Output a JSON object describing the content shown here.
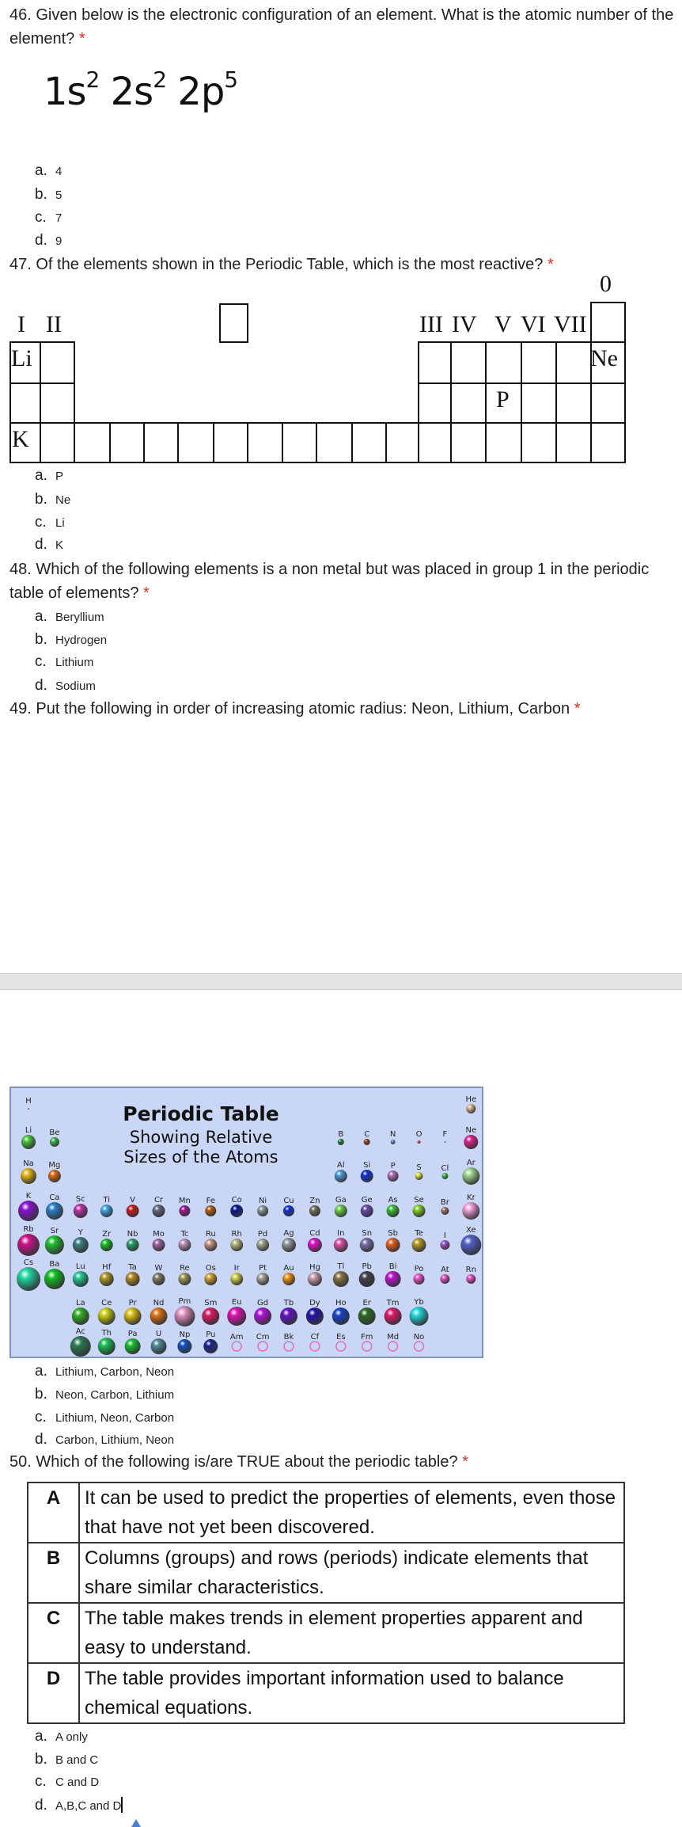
{
  "required_mark": "*",
  "q46": {
    "text": "46. Given below is the electronic configuration of an element. What is the atomic number of the element?",
    "formula": [
      {
        "base": "1s",
        "sup": "2"
      },
      {
        "base": "2s",
        "sup": "2"
      },
      {
        "base": "2p",
        "sup": "5"
      }
    ],
    "options": [
      {
        "letter": "a.",
        "text": "4"
      },
      {
        "letter": "b.",
        "text": "5"
      },
      {
        "letter": "c.",
        "text": "7"
      },
      {
        "letter": "d.",
        "text": "9"
      }
    ]
  },
  "q47": {
    "text": "47. Of the elements shown in the Periodic Table, which is the most reactive?",
    "table": {
      "group_I": "I",
      "group_II": "II",
      "group_III": "III",
      "group_IV": "IV",
      "group_V": "V",
      "group_VI": "VI",
      "group_VII": "VII",
      "group_0": "0",
      "li": "Li",
      "ne": "Ne",
      "p": "P",
      "k": "K"
    },
    "options": [
      {
        "letter": "a.",
        "text": "P"
      },
      {
        "letter": "b.",
        "text": "Ne"
      },
      {
        "letter": "c.",
        "text": "Li"
      },
      {
        "letter": "d.",
        "text": "K"
      }
    ]
  },
  "q48": {
    "text": "48. Which of the following elements is a non metal but was placed in group 1 in the periodic table of elements?",
    "options": [
      {
        "letter": "a.",
        "text": "Beryllium"
      },
      {
        "letter": "b.",
        "text": "Hydrogen"
      },
      {
        "letter": "c.",
        "text": "Lithium"
      },
      {
        "letter": "d.",
        "text": "Sodium"
      }
    ]
  },
  "q49": {
    "text": "49. Put the following in order of increasing atomic radius: Neon, Lithium, Carbon",
    "image": {
      "title": "Periodic Table",
      "subtitle1": "Showing Relative",
      "subtitle2": "Sizes of the Atoms",
      "periods": [
        [
          {
            "s": "H",
            "g": 1,
            "c": "#d04060",
            "size": 1
          },
          {
            "s": "He",
            "g": 18,
            "c": "#d8b890",
            "size": 6
          }
        ],
        [
          {
            "s": "Li",
            "g": 1,
            "c": "#4cc63a",
            "size": 9
          },
          {
            "s": "Be",
            "g": 2,
            "c": "#3cb84a",
            "size": 6
          },
          {
            "s": "B",
            "g": 13,
            "c": "#1e8a2e",
            "size": 4
          },
          {
            "s": "C",
            "g": 14,
            "c": "#8a4020",
            "size": 4
          },
          {
            "s": "N",
            "g": 15,
            "c": "#6a80c0",
            "size": 3
          },
          {
            "s": "O",
            "g": 16,
            "c": "#e04050",
            "size": 2
          },
          {
            "s": "F",
            "g": 17,
            "c": "#5a80d0",
            "size": 1
          },
          {
            "s": "Ne",
            "g": 18,
            "c": "#e0208a",
            "size": 9
          }
        ],
        [
          {
            "s": "Na",
            "g": 1,
            "c": "#e8b810",
            "size": 10
          },
          {
            "s": "Mg",
            "g": 2,
            "c": "#e06a10",
            "size": 8
          },
          {
            "s": "Al",
            "g": 13,
            "c": "#4a9ad8",
            "size": 8
          },
          {
            "s": "Si",
            "g": 14,
            "c": "#1030d0",
            "size": 8
          },
          {
            "s": "P",
            "g": 15,
            "c": "#b070b8",
            "size": 7
          },
          {
            "s": "S",
            "g": 16,
            "c": "#e0e040",
            "size": 5
          },
          {
            "s": "Cl",
            "g": 17,
            "c": "#40c050",
            "size": 4
          },
          {
            "s": "Ar",
            "g": 18,
            "c": "#a0d890",
            "size": 11
          }
        ],
        [
          {
            "s": "K",
            "g": 1,
            "c": "#8a10d0",
            "size": 13
          },
          {
            "s": "Ca",
            "g": 2,
            "c": "#2a80c8",
            "size": 11
          },
          {
            "s": "Sc",
            "g": 3,
            "c": "#c030a8",
            "size": 9
          },
          {
            "s": "Ti",
            "g": 4,
            "c": "#40a8e8",
            "size": 8
          },
          {
            "s": "V",
            "g": 5,
            "c": "#d01818",
            "size": 8
          },
          {
            "s": "Cr",
            "g": 6,
            "c": "#606878",
            "size": 8
          },
          {
            "s": "Mn",
            "g": 7,
            "c": "#a01890",
            "size": 7
          },
          {
            "s": "Fe",
            "g": 8,
            "c": "#b06010",
            "size": 7
          },
          {
            "s": "Co",
            "g": 9,
            "c": "#0a1890",
            "size": 8
          },
          {
            "s": "Ni",
            "g": 10,
            "c": "#8a9898",
            "size": 7
          },
          {
            "s": "Cu",
            "g": 11,
            "c": "#1030d8",
            "size": 7
          },
          {
            "s": "Zn",
            "g": 12,
            "c": "#707058",
            "size": 7
          },
          {
            "s": "Ga",
            "g": 13,
            "c": "#6ad040",
            "size": 8
          },
          {
            "s": "Ge",
            "g": 14,
            "c": "#6a48a8",
            "size": 8
          },
          {
            "s": "As",
            "g": 15,
            "c": "#38c030",
            "size": 8
          },
          {
            "s": "Se",
            "g": 16,
            "c": "#80d020",
            "size": 8
          },
          {
            "s": "Br",
            "g": 17,
            "c": "#a07060",
            "size": 5
          },
          {
            "s": "Kr",
            "g": 18,
            "c": "#f0a0d8",
            "size": 11
          }
        ],
        [
          {
            "s": "Rb",
            "g": 1,
            "c": "#d0108a",
            "size": 14
          },
          {
            "s": "Sr",
            "g": 2,
            "c": "#20c030",
            "size": 12
          },
          {
            "s": "Y",
            "g": 3,
            "c": "#3a8080",
            "size": 10
          },
          {
            "s": "Zr",
            "g": 4,
            "c": "#18c020",
            "size": 8
          },
          {
            "s": "Nb",
            "g": 5,
            "c": "#28a060",
            "size": 8
          },
          {
            "s": "Mo",
            "g": 6,
            "c": "#a060a0",
            "size": 8
          },
          {
            "s": "Tc",
            "g": 7,
            "c": "#c090b8",
            "size": 8
          },
          {
            "s": "Ru",
            "g": 8,
            "c": "#c89880",
            "size": 8
          },
          {
            "s": "Rh",
            "g": 9,
            "c": "#b8b880",
            "size": 8
          },
          {
            "s": "Pd",
            "g": 10,
            "c": "#a0a888",
            "size": 8
          },
          {
            "s": "Ag",
            "g": 11,
            "c": "#909898",
            "size": 9
          },
          {
            "s": "Cd",
            "g": 12,
            "c": "#e010c8",
            "size": 9
          },
          {
            "s": "In",
            "g": 13,
            "c": "#e050a8",
            "size": 9
          },
          {
            "s": "Sn",
            "g": 14,
            "c": "#7870a8",
            "size": 9
          },
          {
            "s": "Sb",
            "g": 15,
            "c": "#e06020",
            "size": 9
          },
          {
            "s": "Te",
            "g": 16,
            "c": "#b89820",
            "size": 9
          },
          {
            "s": "I",
            "g": 17,
            "c": "#a050c8",
            "size": 6
          },
          {
            "s": "Xe",
            "g": 18,
            "c": "#5060c8",
            "size": 13
          }
        ],
        [
          {
            "s": "Cs",
            "g": 1,
            "c": "#20d8a0",
            "size": 15
          },
          {
            "s": "Ba",
            "g": 2,
            "c": "#10c020",
            "size": 13
          },
          {
            "s": "Lu",
            "g": 3,
            "c": "#20c890",
            "size": 10
          },
          {
            "s": "Hf",
            "g": 4,
            "c": "#b09820",
            "size": 9
          },
          {
            "s": "Ta",
            "g": 5,
            "c": "#b88820",
            "size": 9
          },
          {
            "s": "W",
            "g": 6,
            "c": "#7a7a60",
            "size": 8
          },
          {
            "s": "Re",
            "g": 7,
            "c": "#a09850",
            "size": 8
          },
          {
            "s": "Os",
            "g": 8,
            "c": "#d0a030",
            "size": 8
          },
          {
            "s": "Ir",
            "g": 9,
            "c": "#d0d040",
            "size": 8
          },
          {
            "s": "Pt",
            "g": 10,
            "c": "#a8a098",
            "size": 8
          },
          {
            "s": "Au",
            "g": 11,
            "c": "#f09010",
            "size": 8
          },
          {
            "s": "Hg",
            "g": 12,
            "c": "#c8a0b0",
            "size": 9
          },
          {
            "s": "Tl",
            "g": 13,
            "c": "#8a7040",
            "size": 10
          },
          {
            "s": "Pb",
            "g": 14,
            "c": "#404048",
            "size": 10
          },
          {
            "s": "Bi",
            "g": 15,
            "c": "#c010d0",
            "size": 10
          },
          {
            "s": "Po",
            "g": 16,
            "c": "#f050c0",
            "size": 7
          },
          {
            "s": "At",
            "g": 17,
            "c": "#e850c0",
            "size": 6
          },
          {
            "s": "Rn",
            "g": 18,
            "c": "#e850c0",
            "size": 6
          }
        ]
      ],
      "lanthanides": [
        {
          "s": "La",
          "c": "#30b020",
          "size": 11
        },
        {
          "s": "Ce",
          "c": "#c8d010",
          "size": 11
        },
        {
          "s": "Pr",
          "c": "#e0c010",
          "size": 11
        },
        {
          "s": "Nd",
          "c": "#e07010",
          "size": 11
        },
        {
          "s": "Pm",
          "c": "#e090c0",
          "size": 13
        },
        {
          "s": "Sm",
          "c": "#e01860",
          "size": 11
        },
        {
          "s": "Eu",
          "c": "#e010b0",
          "size": 12
        },
        {
          "s": "Gd",
          "c": "#b010d8",
          "size": 11
        },
        {
          "s": "Tb",
          "c": "#6010c0",
          "size": 11
        },
        {
          "s": "Dy",
          "c": "#2010a8",
          "size": 11
        },
        {
          "s": "Ho",
          "c": "#1040c8",
          "size": 11
        },
        {
          "s": "Er",
          "c": "#2a6a20",
          "size": 11
        },
        {
          "s": "Tm",
          "c": "#e01868",
          "size": 11
        },
        {
          "s": "Yb",
          "c": "#20d8d8",
          "size": 12
        }
      ],
      "actinides": [
        {
          "s": "Ac",
          "c": "#2a7a50",
          "size": 13
        },
        {
          "s": "Th",
          "c": "#18c050",
          "size": 11
        },
        {
          "s": "Pa",
          "c": "#18c030",
          "size": 10
        },
        {
          "s": "U",
          "c": "#508898",
          "size": 10
        },
        {
          "s": "Np",
          "c": "#1050c0",
          "size": 9
        },
        {
          "s": "Pu",
          "c": "#1a2090",
          "size": 9
        },
        {
          "s": "Am",
          "c": "#e070c0",
          "size": 6,
          "hollow": true
        },
        {
          "s": "Cm",
          "c": "#e070c0",
          "size": 6,
          "hollow": true
        },
        {
          "s": "Bk",
          "c": "#e070c0",
          "size": 6,
          "hollow": true
        },
        {
          "s": "Cf",
          "c": "#e070c0",
          "size": 6,
          "hollow": true
        },
        {
          "s": "Es",
          "c": "#e070c0",
          "size": 6,
          "hollow": true
        },
        {
          "s": "Fm",
          "c": "#e070c0",
          "size": 6,
          "hollow": true
        },
        {
          "s": "Md",
          "c": "#e070c0",
          "size": 6,
          "hollow": true
        },
        {
          "s": "No",
          "c": "#e070c0",
          "size": 6,
          "hollow": true
        }
      ]
    },
    "options": [
      {
        "letter": "a.",
        "text": "Lithium, Carbon, Neon"
      },
      {
        "letter": "b.",
        "text": "Neon, Carbon, Lithium"
      },
      {
        "letter": "c.",
        "text": "Lithium, Neon, Carbon"
      },
      {
        "letter": "d.",
        "text": "Carbon, Lithium, Neon"
      }
    ]
  },
  "q50": {
    "text": "50. Which of the following is/are TRUE about the periodic table?",
    "statements": [
      {
        "key": "A",
        "text": "It can be used to predict the properties of elements, even those that have not yet been discovered."
      },
      {
        "key": "B",
        "text": "Columns (groups) and rows (periods) indicate elements that share similar characteristics."
      },
      {
        "key": "C",
        "text": "The table makes trends in element properties apparent and easy to understand."
      },
      {
        "key": "D",
        "text": "The table provides important information used to balance chemical equations."
      }
    ],
    "options": [
      {
        "letter": "a.",
        "text": "A only"
      },
      {
        "letter": "b.",
        "text": "B and C"
      },
      {
        "letter": "c.",
        "text": "C and D"
      },
      {
        "letter": "d.",
        "text": "A,B,C and D"
      }
    ]
  },
  "colors": {
    "required": "#d93025",
    "separator": "#e3e3e3",
    "image_bg": "#c9d6f5",
    "caret": "#4a7fd4"
  }
}
